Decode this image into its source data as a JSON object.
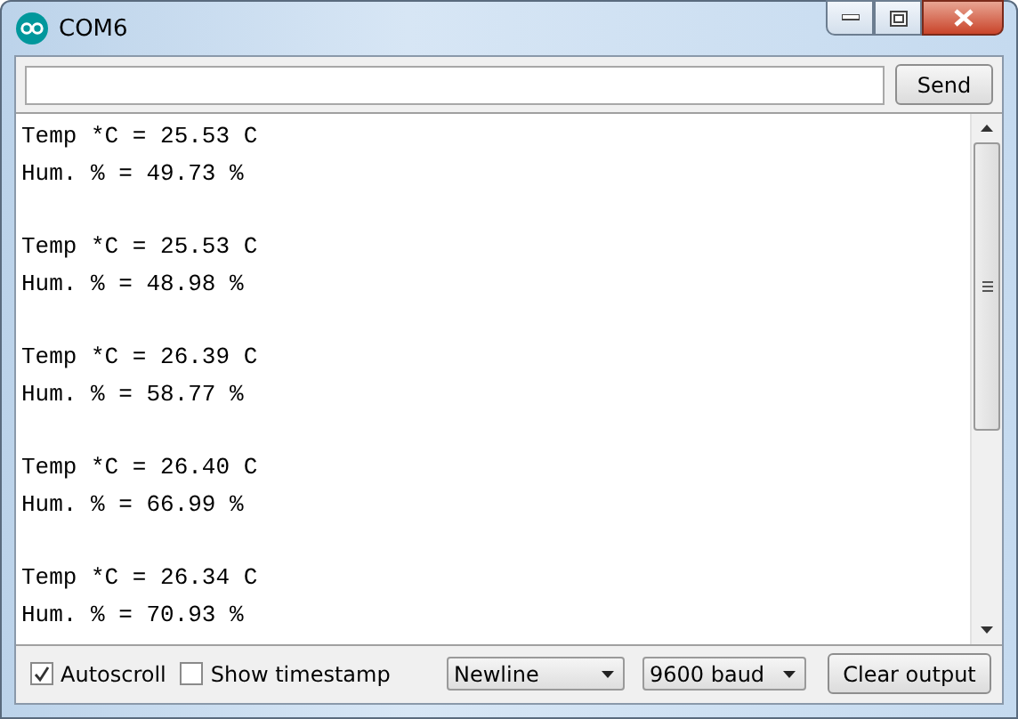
{
  "window": {
    "title": "COM6"
  },
  "send_button": "Send",
  "output": [
    {
      "lines": [
        "Temp *C = 25.53 C",
        "Hum. % = 49.73 %"
      ]
    },
    {
      "lines": [
        "Temp *C = 25.53 C",
        "Hum. % = 48.98 %"
      ]
    },
    {
      "lines": [
        "Temp *C = 26.39 C",
        "Hum. % = 58.77 %"
      ]
    },
    {
      "lines": [
        "Temp *C = 26.40 C",
        "Hum. % = 66.99 %"
      ]
    },
    {
      "lines": [
        "Temp *C = 26.34 C",
        "Hum. % = 70.93 %"
      ]
    }
  ],
  "options": [
    {
      "label": "Autoscroll",
      "checked": true
    },
    {
      "label": "Show timestamp",
      "checked": false
    }
  ],
  "dropdowns": [
    {
      "value": "Newline"
    },
    {
      "value": "9600 baud"
    }
  ],
  "clear_button": "Clear output"
}
